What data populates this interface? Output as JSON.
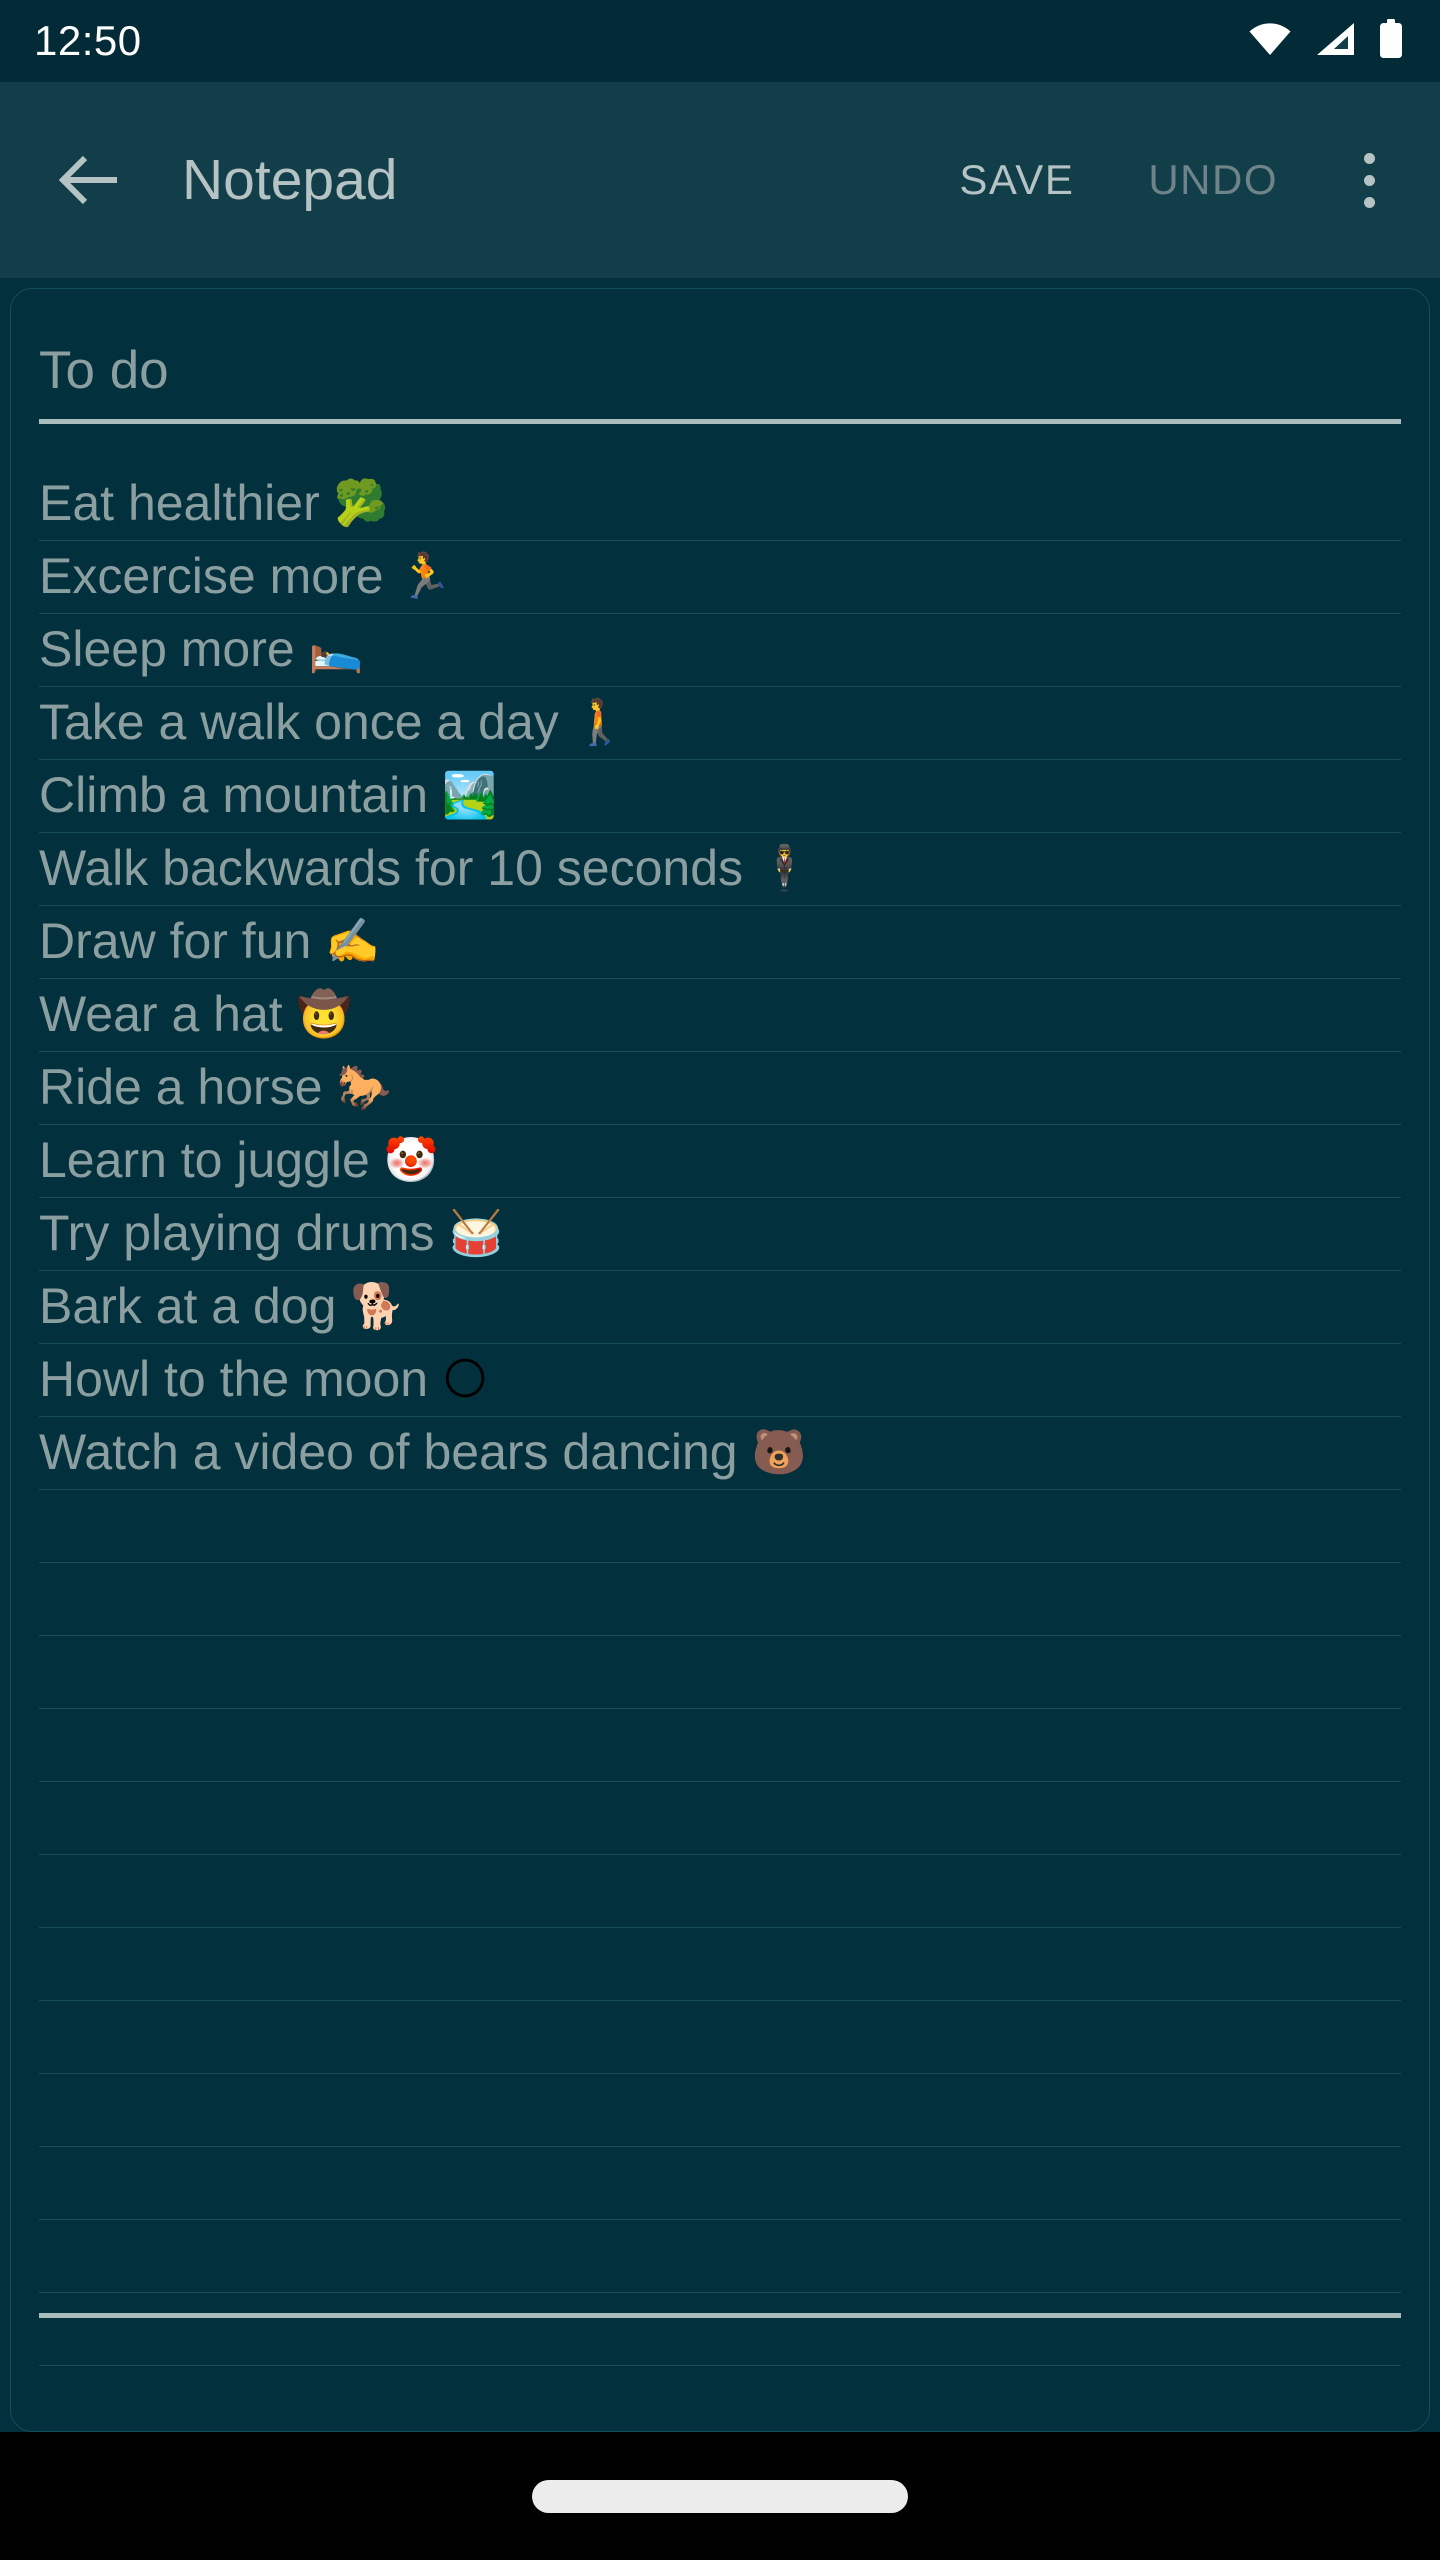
{
  "status_bar": {
    "clock": "12:50",
    "icons": [
      {
        "name": "wifi-icon",
        "label": "Wi-Fi full signal"
      },
      {
        "name": "cellular-signal-icon",
        "label": "Cellular signal"
      },
      {
        "name": "battery-icon",
        "label": "Battery full"
      }
    ]
  },
  "app_bar": {
    "back_label": "Back",
    "title": "Notepad",
    "save_label": "SAVE",
    "undo_label": "UNDO",
    "overflow_label": "More options"
  },
  "note": {
    "title": "To do",
    "title_placeholder": "Title",
    "lines": [
      {
        "text": "Eat healthier",
        "emoji": "🥦",
        "emoji_name": "broccoli-emoji"
      },
      {
        "text": "Excercise more",
        "emoji": "🏃",
        "emoji_name": "runner-emoji"
      },
      {
        "text": "Sleep more",
        "emoji": "🛌",
        "emoji_name": "person-in-bed-emoji"
      },
      {
        "text": "Take a walk once a day",
        "emoji": "🚶",
        "emoji_name": "person-walking-emoji"
      },
      {
        "text": "Climb a mountain",
        "emoji": "🏞️",
        "emoji_name": "national-park-emoji"
      },
      {
        "text": "Walk backwards for 10 seconds",
        "emoji": "🕴️",
        "emoji_name": "person-in-suit-levitating-emoji"
      },
      {
        "text": "Draw for fun",
        "emoji": "✍️",
        "emoji_name": "writing-hand-emoji"
      },
      {
        "text": "Wear a hat",
        "emoji": "🤠",
        "emoji_name": "cowboy-hat-face-emoji"
      },
      {
        "text": "Ride a horse",
        "emoji": "🐎",
        "emoji_name": "horse-emoji"
      },
      {
        "text": "Learn to juggle",
        "emoji": "🤡",
        "emoji_name": "clown-face-emoji"
      },
      {
        "text": "Try playing drums",
        "emoji": "🥁",
        "emoji_name": "drum-emoji"
      },
      {
        "text": "Bark at a dog",
        "emoji": "🐕",
        "emoji_name": "dog-emoji"
      },
      {
        "text": "Howl to the moon",
        "emoji": "🌕",
        "emoji_name": "full-moon-emoji"
      },
      {
        "text": "Watch a video of bears dancing",
        "emoji": "🐻",
        "emoji_name": "bear-emoji"
      },
      {
        "text": "",
        "emoji": "",
        "emoji_name": ""
      },
      {
        "text": "",
        "emoji": "",
        "emoji_name": ""
      },
      {
        "text": "",
        "emoji": "",
        "emoji_name": ""
      },
      {
        "text": "",
        "emoji": "",
        "emoji_name": ""
      },
      {
        "text": "",
        "emoji": "",
        "emoji_name": ""
      },
      {
        "text": "",
        "emoji": "",
        "emoji_name": ""
      },
      {
        "text": "",
        "emoji": "",
        "emoji_name": ""
      },
      {
        "text": "",
        "emoji": "",
        "emoji_name": ""
      },
      {
        "text": "",
        "emoji": "",
        "emoji_name": ""
      },
      {
        "text": "",
        "emoji": "",
        "emoji_name": ""
      },
      {
        "text": "",
        "emoji": "",
        "emoji_name": ""
      },
      {
        "text": "",
        "emoji": "",
        "emoji_name": ""
      },
      {
        "text": "",
        "emoji": "",
        "emoji_name": ""
      },
      {
        "text": "",
        "emoji": "",
        "emoji_name": ""
      }
    ]
  },
  "nav_bar": {
    "gesture_handle_label": "Home gesture handle"
  },
  "colors": {
    "status_bar_bg": "#022b37",
    "app_bar_bg": "#113e48",
    "page_bg": "#03303d",
    "text_primary": "#b6c3c4",
    "text_muted": "#8b9fa1",
    "text_disabled": "#6e8489",
    "rule_line": "#17505b",
    "accent_underline": "#a9bdbe",
    "nav_bar_bg": "#000000"
  }
}
